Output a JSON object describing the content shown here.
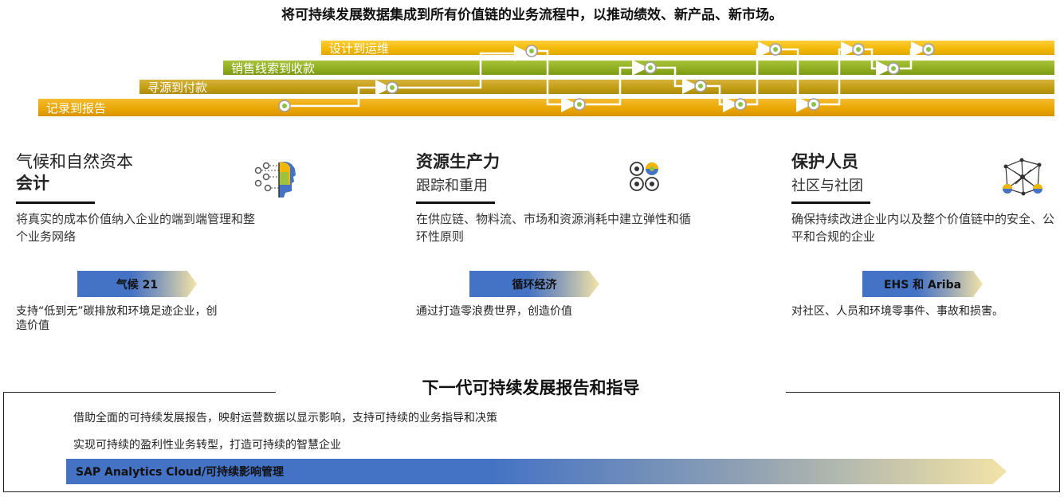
{
  "header": {
    "title": "将可持续发展数据集成到所有价值链的业务流程中，以推动绩效、新产品、新市场。"
  },
  "flow_bands": [
    {
      "label": "设计到运维",
      "color": "#f2b705"
    },
    {
      "label": "销售线索到收款",
      "color": "#8eac1e"
    },
    {
      "label": "寻源到付款",
      "color": "#c29d14"
    },
    {
      "label": "记录到报告",
      "color": "#e9a500"
    }
  ],
  "columns": [
    {
      "title_line1": "气候和自然资本",
      "title_line2": "会计",
      "subtitle": "",
      "icon": "ai-head-icon",
      "description": "将真实的成本价值纳入企业的端到端管理和整个业务网络",
      "tag": "气候 21",
      "tag_description": "支持“低到无”碳排放和环境足迹企业，创造价值"
    },
    {
      "title_line1": "资源生产力",
      "title_line2": "",
      "subtitle": "跟踪和重用",
      "icon": "circles-grid-icon",
      "description": "在供应链、物料流、市场和资源消耗中建立弹性和循环性原则",
      "tag": "循环经济",
      "tag_description": "通过打造零浪费世界，创造价值"
    },
    {
      "title_line1": "保护人员",
      "title_line2": "",
      "subtitle": "社区与社团",
      "icon": "network-icon",
      "description": "确保持续改进企业内以及整个价值链中的安全、公平和合规的企业",
      "tag": "EHS 和 Ariba",
      "tag_description": "对社区、人员和环境零事件、事故和损害。"
    }
  ],
  "bottom": {
    "title": "下一代可持续发展报告和指导",
    "line1": "借助全面的可持续发展报告，映射运营数据以显示影响，支持可持续的业务指导和决策",
    "line2": "实现可持续的盈利性业务转型，打造可持续的智慧企业",
    "bar_label": "SAP Analytics Cloud/可持续影响管理"
  },
  "colors": {
    "accent_blue": "#4472c4",
    "accent_cream": "#f3e3a6",
    "node_green": "#8bc34a"
  }
}
